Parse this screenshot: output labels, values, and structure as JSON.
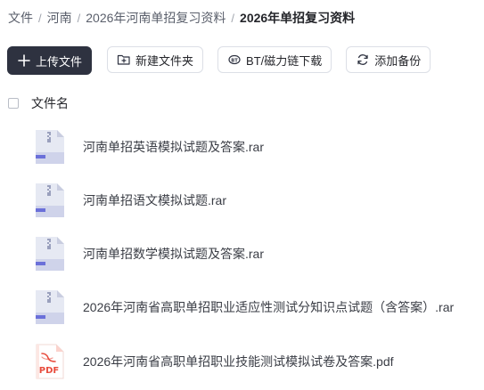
{
  "breadcrumb": [
    "文件",
    "河南",
    "2026年河南单招复习资料",
    "2026年单招复习资料"
  ],
  "toolbar": {
    "upload_label": "上传文件",
    "new_folder_label": "新建文件夹",
    "bt_label": "BT/磁力链下载",
    "backup_label": "添加备份"
  },
  "list_header": {
    "name_label": "文件名"
  },
  "files": [
    {
      "name": "河南单招英语模拟试题及答案.rar",
      "type": "rar"
    },
    {
      "name": "河南单招语文模拟试题.rar",
      "type": "rar"
    },
    {
      "name": "河南单招数学模拟试题及答案.rar",
      "type": "rar"
    },
    {
      "name": "2026年河南省高职单招职业适应性测试分知识点试题（含答案）.rar",
      "type": "rar"
    },
    {
      "name": "2026年河南省高职单招职业技能测试模拟试卷及答案.pdf",
      "type": "pdf",
      "badge": "PDF"
    }
  ],
  "colors": {
    "primary_button": "#2e3240",
    "pdf_accent": "#e84c3d",
    "archive_accent": "#6b70d9"
  }
}
